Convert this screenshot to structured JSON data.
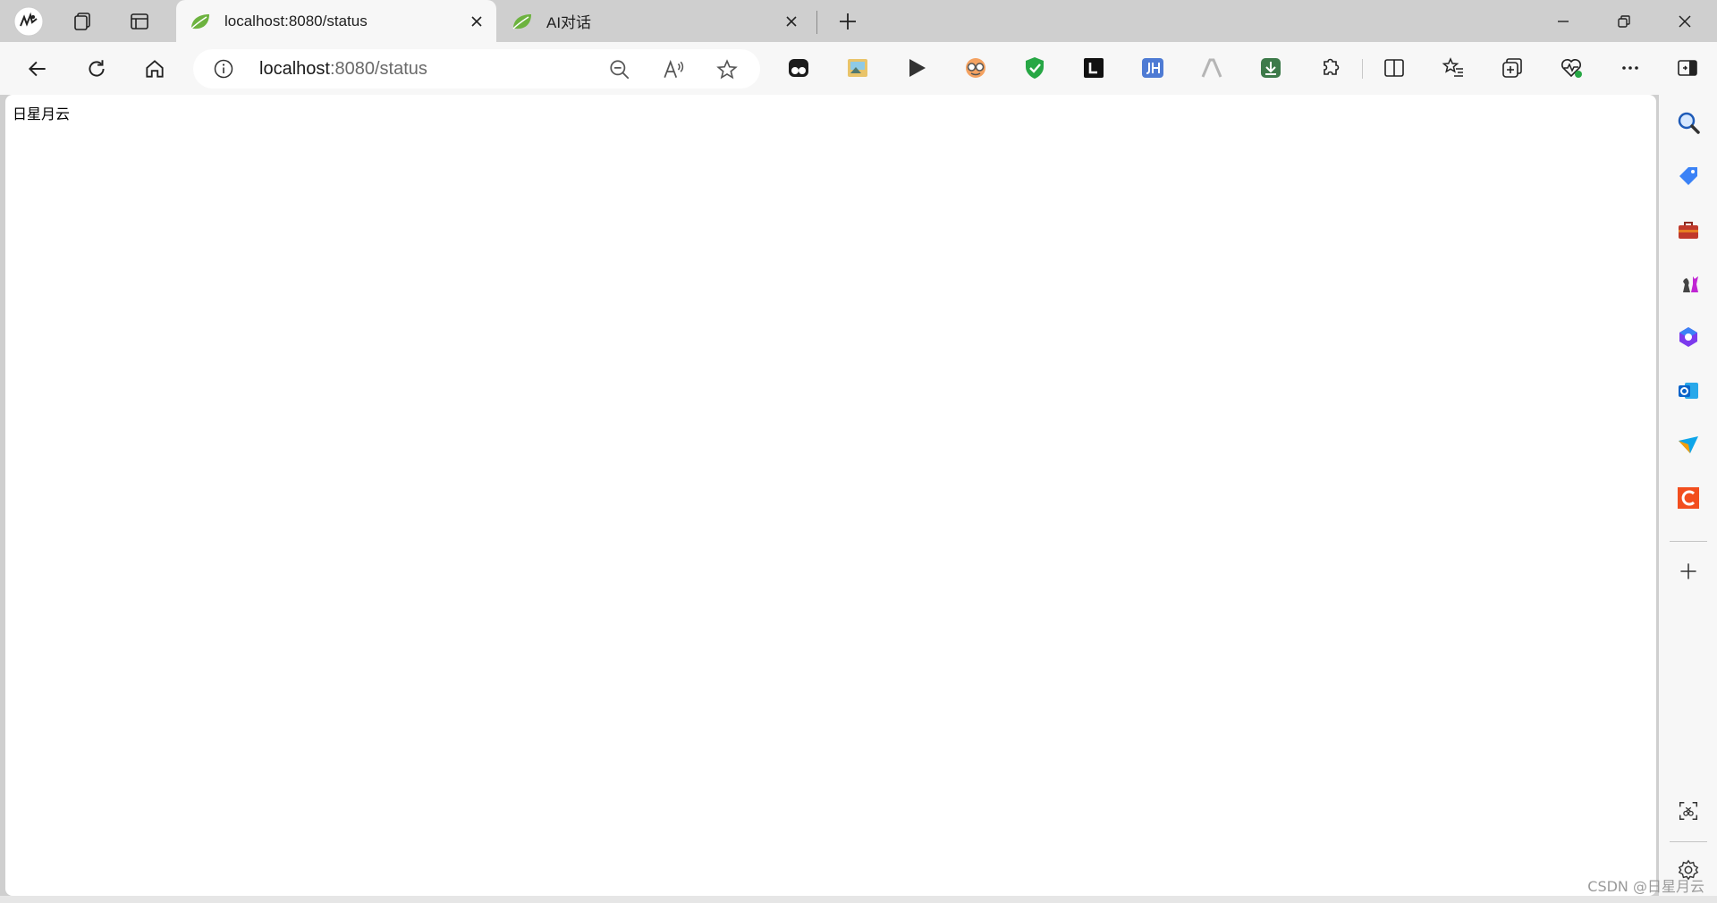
{
  "browser": {
    "tabs": [
      {
        "title": "localhost:8080/status",
        "active": true
      },
      {
        "title": "AI对话",
        "active": false
      }
    ],
    "address": {
      "host": "localhost",
      "rest": ":8080/status"
    },
    "toolbar_extensions": [
      "bear-icon",
      "image-extension-icon",
      "play-icon",
      "glasses-face-icon",
      "shield-check-icon",
      "l-extension-icon",
      "jh-extension-icon",
      "a-extension-icon",
      "download-extension-icon"
    ],
    "sidebar_items": [
      "search-icon",
      "tag-icon",
      "toolbox-icon",
      "chess-icon",
      "microsoft365-icon",
      "outlook-icon",
      "send-icon",
      "c-app-icon"
    ]
  },
  "page": {
    "body_text": "日星月云"
  },
  "watermark": "CSDN @日星月云",
  "colors": {
    "accent_leaf": "#6db33f",
    "shield_green": "#27a745",
    "jh_blue": "#4e7bd4",
    "c_red": "#f24e1e"
  }
}
